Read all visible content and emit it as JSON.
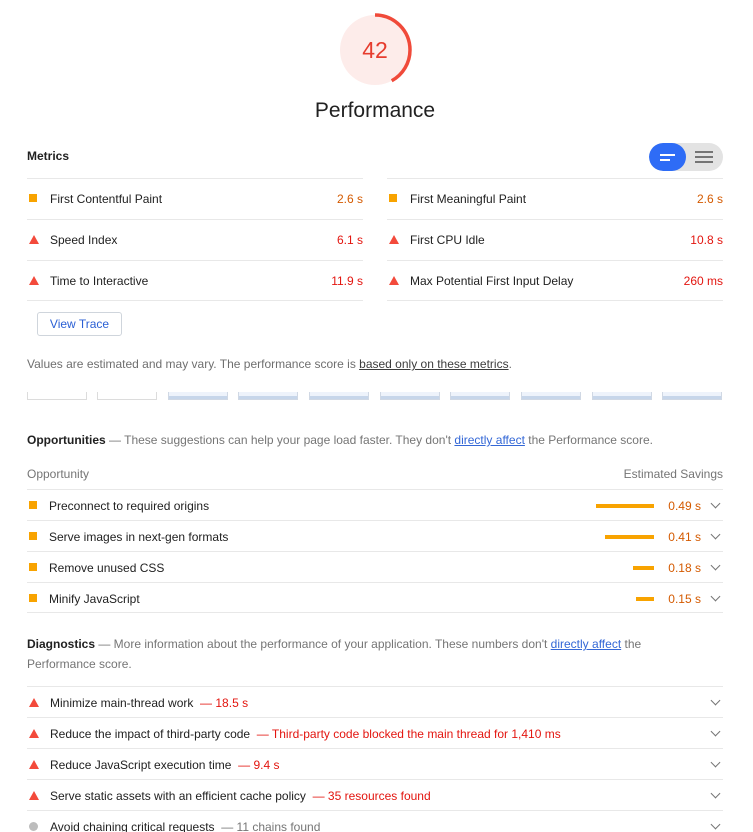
{
  "gauge": {
    "score": "42",
    "label": "Performance",
    "fraction": 0.42,
    "color": "#e63c2e"
  },
  "metrics": {
    "title": "Metrics",
    "left": [
      {
        "marker": "square",
        "label": "First Contentful Paint",
        "value": "2.6 s",
        "status": "average"
      },
      {
        "marker": "triangle",
        "label": "Speed Index",
        "value": "6.1 s",
        "status": "fail"
      },
      {
        "marker": "triangle",
        "label": "Time to Interactive",
        "value": "11.9 s",
        "status": "fail"
      }
    ],
    "right": [
      {
        "marker": "square",
        "label": "First Meaningful Paint",
        "value": "2.6 s",
        "status": "average"
      },
      {
        "marker": "triangle",
        "label": "First CPU Idle",
        "value": "10.8 s",
        "status": "fail"
      },
      {
        "marker": "triangle",
        "label": "Max Potential First Input Delay",
        "value": "260 ms",
        "status": "fail"
      }
    ],
    "view_trace": "View Trace"
  },
  "note": {
    "text": "Values are estimated and may vary. The performance score is ",
    "link": "based only on these metrics",
    "tail": "."
  },
  "opportunities": {
    "title": "Opportunities",
    "dash": " — These suggestions can help your page load faster. They don't ",
    "link": "directly affect",
    "tail": " the Performance score.",
    "col_left": "Opportunity",
    "col_right": "Estimated Savings",
    "items": [
      {
        "label": "Preconnect to required origins",
        "value": "0.49 s",
        "savings": 0.49
      },
      {
        "label": "Serve images in next-gen formats",
        "value": "0.41 s",
        "savings": 0.41
      },
      {
        "label": "Remove unused CSS",
        "value": "0.18 s",
        "savings": 0.18
      },
      {
        "label": "Minify JavaScript",
        "value": "0.15 s",
        "savings": 0.15
      }
    ]
  },
  "diagnostics": {
    "title": "Diagnostics",
    "dash": " — More information about the performance of your application. These numbers don't ",
    "link": "directly affect",
    "tail": " the",
    "line2": "Performance score.",
    "items": [
      {
        "marker": "triangle",
        "label": "Minimize main-thread work",
        "detail": "— 18.5 s"
      },
      {
        "marker": "triangle",
        "label": "Reduce the impact of third-party code",
        "detail": "— Third-party code blocked the main thread for 1,410 ms"
      },
      {
        "marker": "triangle",
        "label": "Reduce JavaScript execution time",
        "detail": "— 9.4 s"
      },
      {
        "marker": "triangle",
        "label": "Serve static assets with an efficient cache policy",
        "detail": "— 35 resources found"
      },
      {
        "marker": "circle",
        "label": "Avoid chaining critical requests",
        "detail": "— 11 chains found"
      }
    ]
  },
  "colors": {
    "fail": "#e3150f",
    "average": "#d45a00",
    "bar": "#f8a300",
    "accent": "#2e6cf6"
  }
}
